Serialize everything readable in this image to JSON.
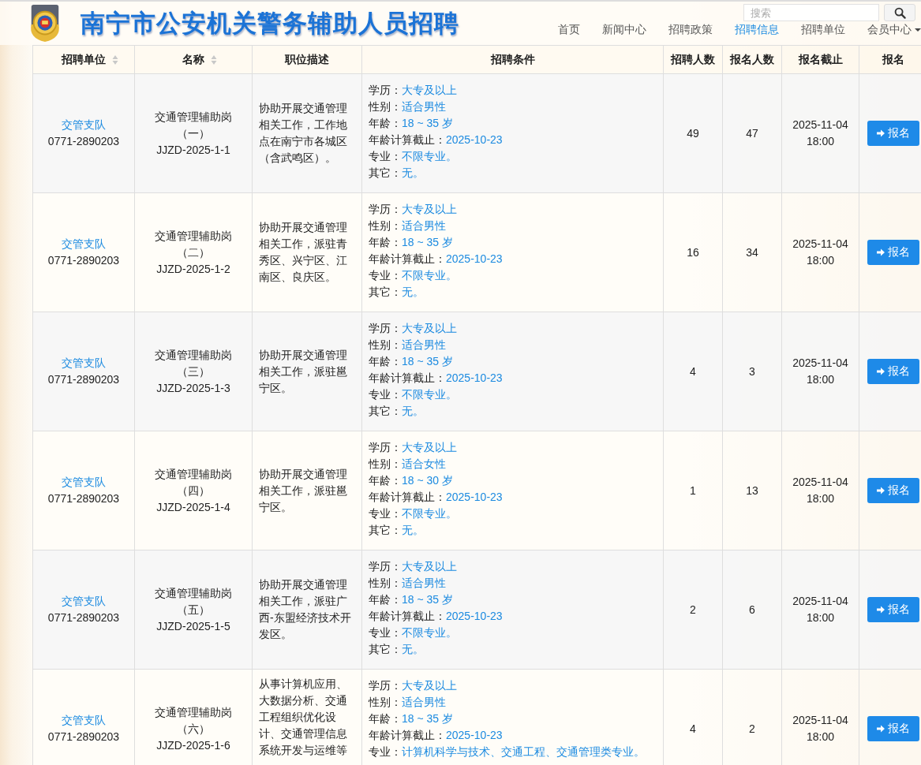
{
  "header": {
    "title": "南宁市公安机关警务辅助人员招聘",
    "nav": [
      {
        "label": "首页",
        "selected": false,
        "dropdown": false
      },
      {
        "label": "新闻中心",
        "selected": false,
        "dropdown": false
      },
      {
        "label": "招聘政策",
        "selected": false,
        "dropdown": false
      },
      {
        "label": "招聘信息",
        "selected": true,
        "dropdown": false
      },
      {
        "label": "招聘单位",
        "selected": false,
        "dropdown": false
      },
      {
        "label": "会员中心",
        "selected": false,
        "dropdown": true
      }
    ],
    "search": {
      "placeholder": "搜索"
    }
  },
  "table": {
    "columns": [
      {
        "label": "招聘单位",
        "sortable": true
      },
      {
        "label": "名称",
        "sortable": true
      },
      {
        "label": "职位描述",
        "sortable": false
      },
      {
        "label": "招聘条件",
        "sortable": false
      },
      {
        "label": "招聘人数",
        "sortable": false
      },
      {
        "label": "报名人数",
        "sortable": false
      },
      {
        "label": "报名截止",
        "sortable": false
      },
      {
        "label": "报名",
        "sortable": false
      }
    ],
    "rows": [
      {
        "unit": "交管支队",
        "phone": "0771-2890203",
        "name": "交通管理辅助岗",
        "number": "（一）",
        "code": "JJZD-2025-1-1",
        "description": "协助开展交通管理相关工作，工作地点在南宁市各城区（含武鸣区）。",
        "conditions": [
          {
            "label": "学历：",
            "value": "大专及以上"
          },
          {
            "label": "性别：",
            "value": "适合男性"
          },
          {
            "label": "年龄：",
            "value": "18 ~ 35 岁"
          },
          {
            "label": "年龄计算截止：",
            "value": "2025-10-23"
          },
          {
            "label": "专业：",
            "value": "不限专业。"
          },
          {
            "label": "其它：",
            "value": "无。"
          }
        ],
        "quota": "49",
        "applicants": "47",
        "deadline_date": "2025-11-04",
        "deadline_time": "18:00",
        "button": "报名"
      },
      {
        "unit": "交管支队",
        "phone": "0771-2890203",
        "name": "交通管理辅助岗",
        "number": "（二）",
        "code": "JJZD-2025-1-2",
        "description": "协助开展交通管理相关工作，派驻青秀区、兴宁区、江南区、良庆区。",
        "conditions": [
          {
            "label": "学历：",
            "value": "大专及以上"
          },
          {
            "label": "性别：",
            "value": "适合男性"
          },
          {
            "label": "年龄：",
            "value": "18 ~ 35 岁"
          },
          {
            "label": "年龄计算截止：",
            "value": "2025-10-23"
          },
          {
            "label": "专业：",
            "value": "不限专业。"
          },
          {
            "label": "其它：",
            "value": "无。"
          }
        ],
        "quota": "16",
        "applicants": "34",
        "deadline_date": "2025-11-04",
        "deadline_time": "18:00",
        "button": "报名"
      },
      {
        "unit": "交管支队",
        "phone": "0771-2890203",
        "name": "交通管理辅助岗",
        "number": "（三）",
        "code": "JJZD-2025-1-3",
        "description": "协助开展交通管理相关工作，派驻邕宁区。",
        "conditions": [
          {
            "label": "学历：",
            "value": "大专及以上"
          },
          {
            "label": "性别：",
            "value": "适合男性"
          },
          {
            "label": "年龄：",
            "value": "18 ~ 35 岁"
          },
          {
            "label": "年龄计算截止：",
            "value": "2025-10-23"
          },
          {
            "label": "专业：",
            "value": "不限专业。"
          },
          {
            "label": "其它：",
            "value": "无。"
          }
        ],
        "quota": "4",
        "applicants": "3",
        "deadline_date": "2025-11-04",
        "deadline_time": "18:00",
        "button": "报名"
      },
      {
        "unit": "交管支队",
        "phone": "0771-2890203",
        "name": "交通管理辅助岗",
        "number": "（四）",
        "code": "JJZD-2025-1-4",
        "description": "协助开展交通管理相关工作，派驻邕宁区。",
        "conditions": [
          {
            "label": "学历：",
            "value": "大专及以上"
          },
          {
            "label": "性别：",
            "value": "适合女性"
          },
          {
            "label": "年龄：",
            "value": "18 ~ 30 岁"
          },
          {
            "label": "年龄计算截止：",
            "value": "2025-10-23"
          },
          {
            "label": "专业：",
            "value": "不限专业。"
          },
          {
            "label": "其它：",
            "value": "无。"
          }
        ],
        "quota": "1",
        "applicants": "13",
        "deadline_date": "2025-11-04",
        "deadline_time": "18:00",
        "button": "报名"
      },
      {
        "unit": "交管支队",
        "phone": "0771-2890203",
        "name": "交通管理辅助岗",
        "number": "（五）",
        "code": "JJZD-2025-1-5",
        "description": "协助开展交通管理相关工作，派驻广西-东盟经济技术开发区。",
        "conditions": [
          {
            "label": "学历：",
            "value": "大专及以上"
          },
          {
            "label": "性别：",
            "value": "适合男性"
          },
          {
            "label": "年龄：",
            "value": "18 ~ 35 岁"
          },
          {
            "label": "年龄计算截止：",
            "value": "2025-10-23"
          },
          {
            "label": "专业：",
            "value": "不限专业。"
          },
          {
            "label": "其它：",
            "value": "无。"
          }
        ],
        "quota": "2",
        "applicants": "6",
        "deadline_date": "2025-11-04",
        "deadline_time": "18:00",
        "button": "报名"
      },
      {
        "unit": "交管支队",
        "phone": "0771-2890203",
        "name": "交通管理辅助岗",
        "number": "（六）",
        "code": "JJZD-2025-1-6",
        "description": "从事计算机应用、大数据分析、交通工程组织优化设计、交通管理信息系统开发与运维等",
        "conditions": [
          {
            "label": "学历：",
            "value": "大专及以上"
          },
          {
            "label": "性别：",
            "value": "适合男性"
          },
          {
            "label": "年龄：",
            "value": "18 ~ 35 岁"
          },
          {
            "label": "年龄计算截止：",
            "value": "2025-10-23"
          },
          {
            "label": "专业：",
            "value": "计算机科学与技术、交通工程、交通管理类专业。"
          }
        ],
        "quota": "4",
        "applicants": "2",
        "deadline_date": "2025-11-04",
        "deadline_time": "18:00",
        "button": "报名"
      }
    ]
  }
}
